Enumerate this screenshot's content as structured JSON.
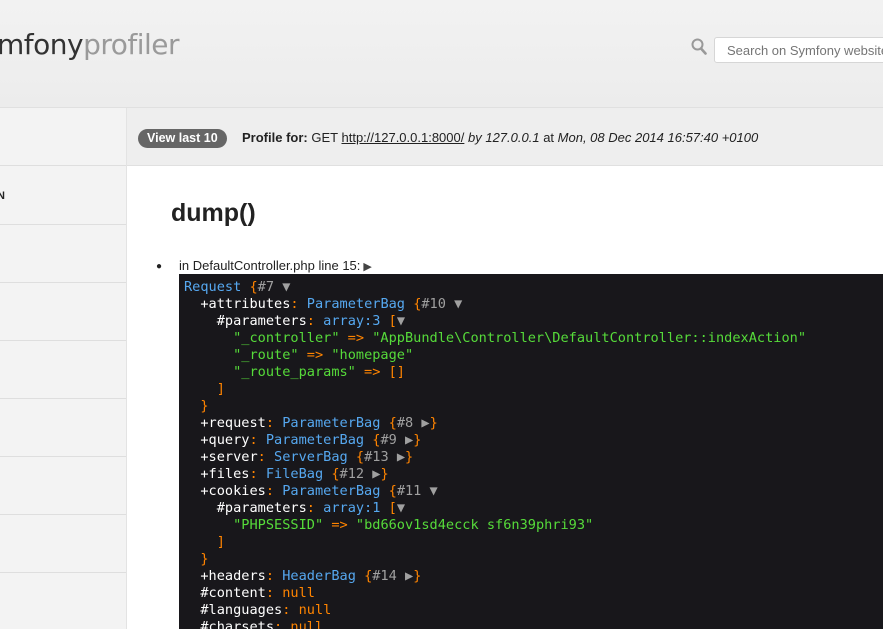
{
  "header": {
    "logo_part1": "mfony",
    "logo_part2": "profiler",
    "search_placeholder": "Search on Symfony website"
  },
  "sidebar": {
    "items": [
      {
        "label": ""
      },
      {
        "label": "N"
      },
      {
        "label": ""
      },
      {
        "label": ""
      },
      {
        "label": ""
      },
      {
        "label": ""
      },
      {
        "label": ""
      },
      {
        "label": ""
      }
    ]
  },
  "profile_bar": {
    "view_last_label": "View last 10",
    "profile_for_label": "Profile for:",
    "method": "GET",
    "url": "http://127.0.0.1:8000/",
    "by_text": "by 127.0.0.1",
    "at_text": "at",
    "date_text": "Mon, 08 Dec 2014 16:57:40 +0100"
  },
  "main": {
    "title": "dump()",
    "dump_location": "in DefaultController.php line 15:"
  },
  "dump": {
    "lines": [
      [
        [
          "c",
          "Request "
        ],
        [
          "o",
          "{"
        ],
        [
          "n",
          "#7"
        ],
        [
          "t",
          " ▼"
        ]
      ],
      [
        [
          "k",
          "  +attributes"
        ],
        [
          "o",
          ": "
        ],
        [
          "c",
          "ParameterBag "
        ],
        [
          "o",
          "{"
        ],
        [
          "n",
          "#10"
        ],
        [
          "t",
          " ▼"
        ]
      ],
      [
        [
          "k",
          "    #parameters"
        ],
        [
          "o",
          ": "
        ],
        [
          "c",
          "array:3 "
        ],
        [
          "o",
          "["
        ],
        [
          "t",
          "▼"
        ]
      ],
      [
        [
          "s",
          "      \"_controller\""
        ],
        [
          "o",
          " => "
        ],
        [
          "s",
          "\"AppBundle\\Controller\\DefaultController::indexAction\""
        ]
      ],
      [
        [
          "s",
          "      \"_route\""
        ],
        [
          "o",
          " => "
        ],
        [
          "s",
          "\"homepage\""
        ]
      ],
      [
        [
          "s",
          "      \"_route_params\""
        ],
        [
          "o",
          " => []"
        ]
      ],
      [
        [
          "o",
          "    ]"
        ]
      ],
      [
        [
          "o",
          "  }"
        ]
      ],
      [
        [
          "k",
          "  +request"
        ],
        [
          "o",
          ": "
        ],
        [
          "c",
          "ParameterBag "
        ],
        [
          "o",
          "{"
        ],
        [
          "n",
          "#8"
        ],
        [
          "t",
          " ▶"
        ],
        [
          "o",
          "}"
        ]
      ],
      [
        [
          "k",
          "  +query"
        ],
        [
          "o",
          ": "
        ],
        [
          "c",
          "ParameterBag "
        ],
        [
          "o",
          "{"
        ],
        [
          "n",
          "#9"
        ],
        [
          "t",
          " ▶"
        ],
        [
          "o",
          "}"
        ]
      ],
      [
        [
          "k",
          "  +server"
        ],
        [
          "o",
          ": "
        ],
        [
          "c",
          "ServerBag "
        ],
        [
          "o",
          "{"
        ],
        [
          "n",
          "#13"
        ],
        [
          "t",
          " ▶"
        ],
        [
          "o",
          "}"
        ]
      ],
      [
        [
          "k",
          "  +files"
        ],
        [
          "o",
          ": "
        ],
        [
          "c",
          "FileBag "
        ],
        [
          "o",
          "{"
        ],
        [
          "n",
          "#12"
        ],
        [
          "t",
          " ▶"
        ],
        [
          "o",
          "}"
        ]
      ],
      [
        [
          "k",
          "  +cookies"
        ],
        [
          "o",
          ": "
        ],
        [
          "c",
          "ParameterBag "
        ],
        [
          "o",
          "{"
        ],
        [
          "n",
          "#11"
        ],
        [
          "t",
          " ▼"
        ]
      ],
      [
        [
          "k",
          "    #parameters"
        ],
        [
          "o",
          ": "
        ],
        [
          "c",
          "array:1 "
        ],
        [
          "o",
          "["
        ],
        [
          "t",
          "▼"
        ]
      ],
      [
        [
          "s",
          "      \"PHPSESSID\""
        ],
        [
          "o",
          " => "
        ],
        [
          "s",
          "\"bd66ov1sd4ecck sf6n39phri93\""
        ]
      ],
      [
        [
          "o",
          "    ]"
        ]
      ],
      [
        [
          "o",
          "  }"
        ]
      ],
      [
        [
          "k",
          "  +headers"
        ],
        [
          "o",
          ": "
        ],
        [
          "c",
          "HeaderBag "
        ],
        [
          "o",
          "{"
        ],
        [
          "n",
          "#14"
        ],
        [
          "t",
          " ▶"
        ],
        [
          "o",
          "}"
        ]
      ],
      [
        [
          "k",
          "  #content"
        ],
        [
          "o",
          ": null"
        ]
      ],
      [
        [
          "k",
          "  #languages"
        ],
        [
          "o",
          ": null"
        ]
      ],
      [
        [
          "k",
          "  #charsets"
        ],
        [
          "o",
          ": null"
        ]
      ]
    ]
  }
}
